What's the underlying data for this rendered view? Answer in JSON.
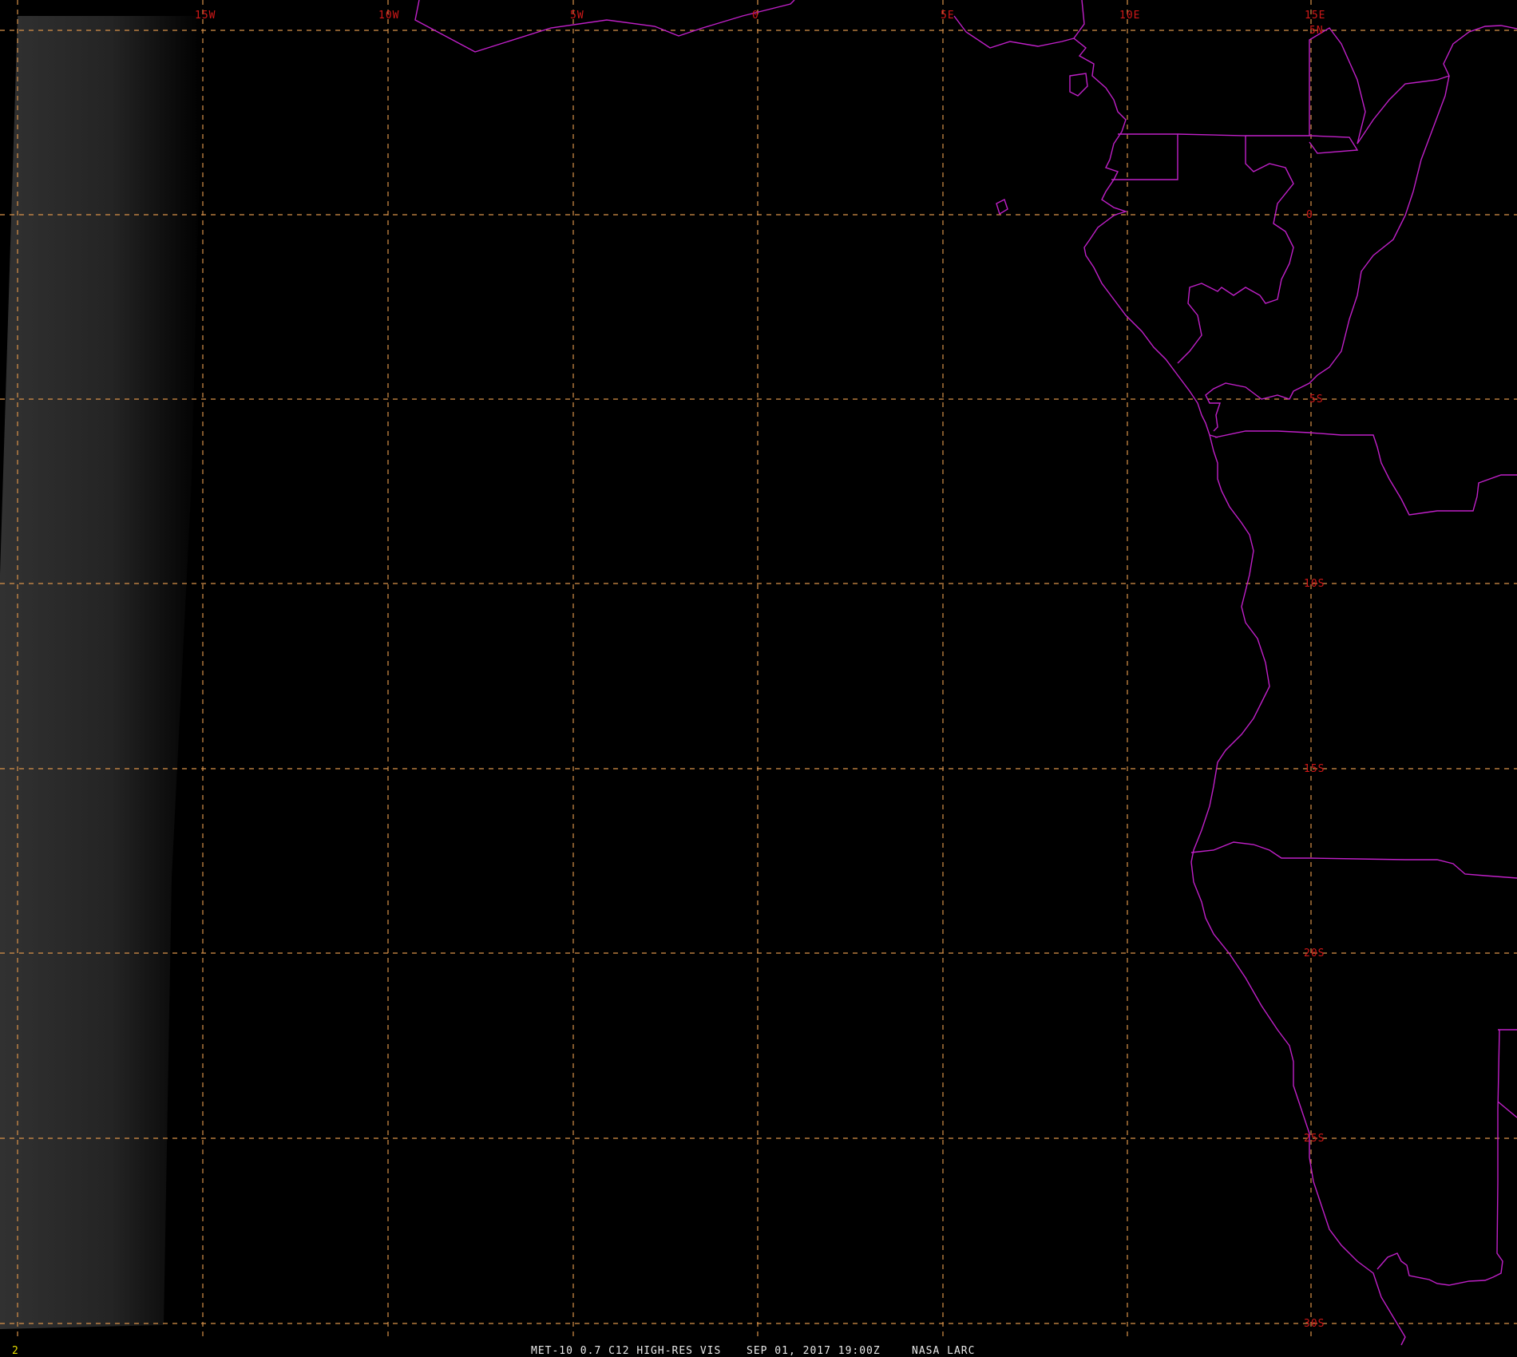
{
  "map": {
    "longitude_labels": [
      "15W",
      "10W",
      "5W",
      "0",
      "5E",
      "10E",
      "15E"
    ],
    "latitude_labels": [
      "5N",
      "0",
      "5S",
      "10S",
      "15S",
      "20S",
      "25S",
      "30S"
    ],
    "grid_color": "#d9924a",
    "boundary_color": "#c020c8",
    "label_color": "#d01818"
  },
  "footer": {
    "frame_number": "2",
    "product": "MET-10 0.7 C12 HIGH-RES VIS",
    "datetime": "SEP 01, 2017 19:00Z",
    "credit": "NASA LARC"
  }
}
